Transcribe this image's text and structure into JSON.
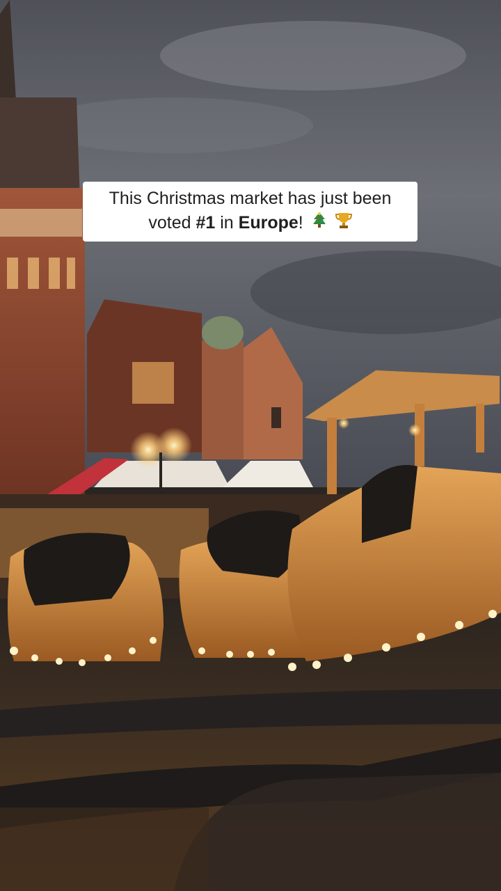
{
  "caption": {
    "line1": "This Christmas market has just been",
    "line2_prefix": "voted ",
    "line2_rank": "#1",
    "line2_mid": " in ",
    "line2_place": "Europe",
    "line2_suffix": "!",
    "emojis": [
      "christmas-tree-icon",
      "trophy-icon"
    ]
  },
  "colors": {
    "sky": "#5b5e66",
    "brick": "#8a4a32",
    "warm_light": "#ffcf7a",
    "wood": "#c8873a"
  }
}
